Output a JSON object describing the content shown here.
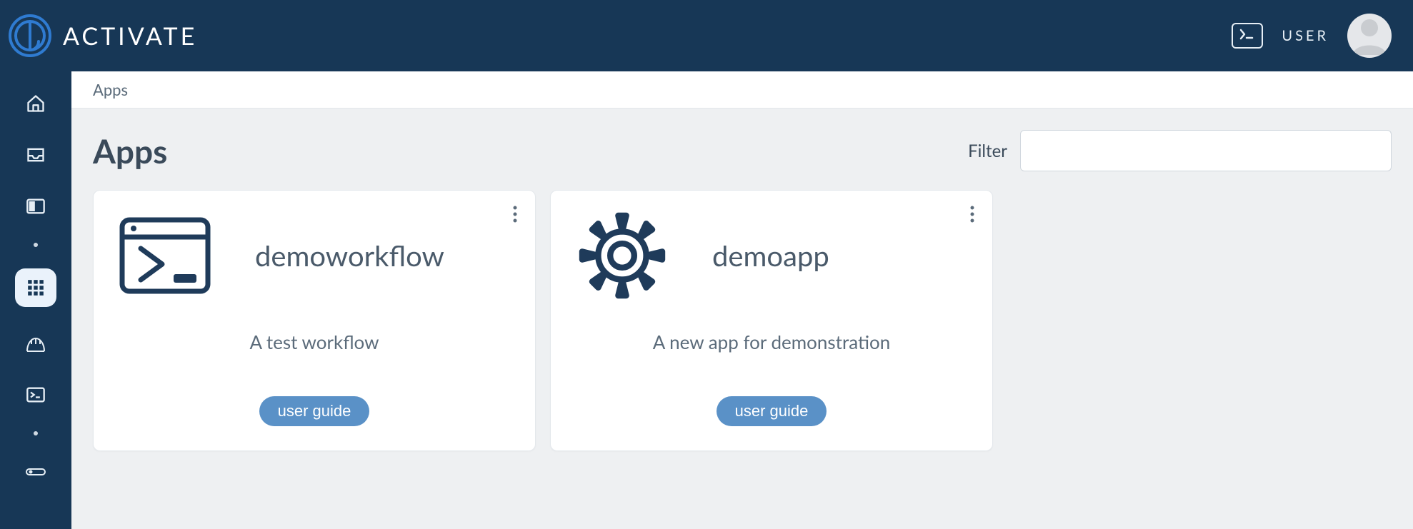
{
  "brand": {
    "name": "ACTIVATE"
  },
  "header": {
    "user_label": "USER"
  },
  "breadcrumb": "Apps",
  "page_title": "Apps",
  "filter": {
    "label": "Filter",
    "value": ""
  },
  "apps": [
    {
      "name": "demoworkflow",
      "description": "A test workflow",
      "guide_label": "user guide",
      "icon": "terminal-window"
    },
    {
      "name": "demoapp",
      "description": "A new app for demonstration",
      "guide_label": "user guide",
      "icon": "gear"
    }
  ]
}
